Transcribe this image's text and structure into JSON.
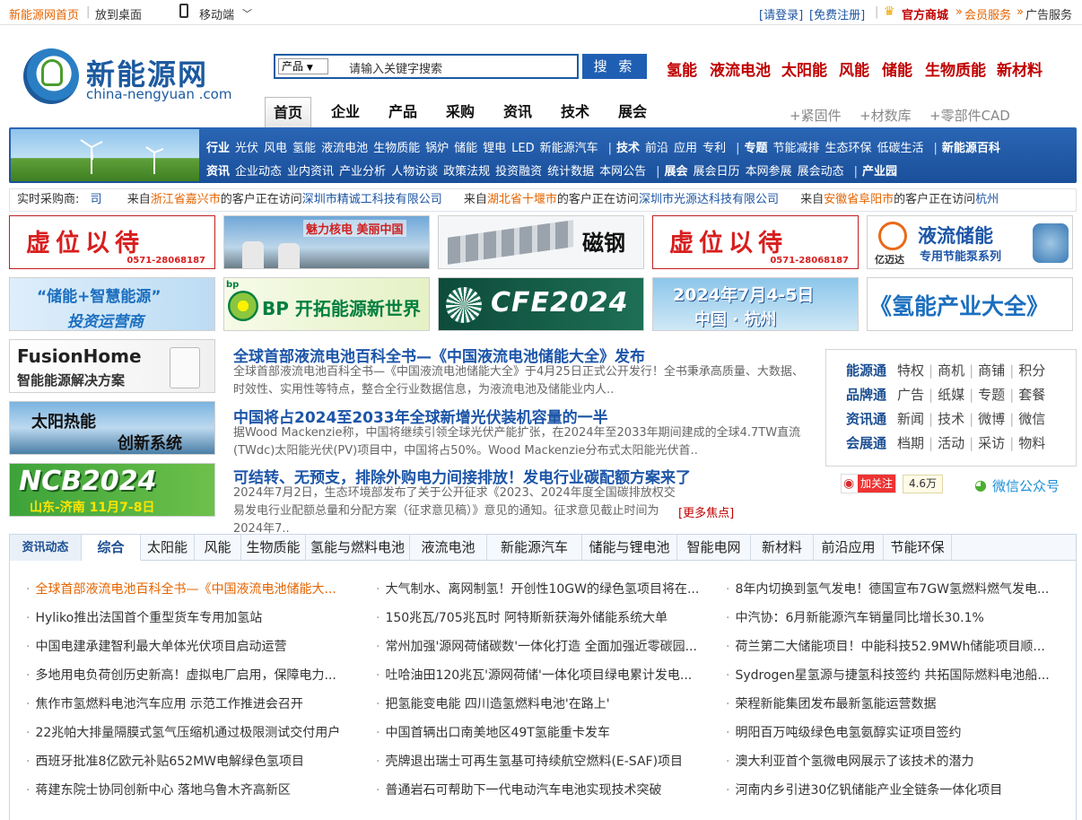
{
  "topbar": {
    "home": "新能源网首页",
    "desktop": "放到桌面",
    "mobile": "移动端",
    "login": "[请登录]",
    "register": "[免费注册]",
    "mall": "官方商城",
    "vip": "会员服务",
    "ads": "广告服务"
  },
  "logo": {
    "cn": "新能源网",
    "en": "china-nengyuan .com"
  },
  "search": {
    "select": "产品",
    "placeholder": "请输入关键字搜索",
    "button": "搜 索"
  },
  "hotcats": [
    "氢能",
    "液流电池",
    "太阳能",
    "风能",
    "储能",
    "生物质能",
    "新材料"
  ],
  "nav": {
    "tabs": [
      "首页",
      "企业",
      "产品",
      "采购",
      "资讯",
      "技术",
      "展会"
    ],
    "extra": [
      "+紧固件",
      "+材数库",
      "+零部件CAD"
    ]
  },
  "band": {
    "row1": [
      {
        "t": "行业",
        "b": true
      },
      {
        "t": "光伏"
      },
      {
        "t": "风电"
      },
      {
        "t": "氢能"
      },
      {
        "t": "液流电池"
      },
      {
        "t": "生物质能"
      },
      {
        "t": "锅炉"
      },
      {
        "t": "储能"
      },
      {
        "t": "锂电"
      },
      {
        "t": "LED"
      },
      {
        "t": "新能源汽车",
        "sep": true
      },
      {
        "t": "技术",
        "b": true
      },
      {
        "t": "前沿"
      },
      {
        "t": "应用"
      },
      {
        "t": "专利",
        "sep": true
      },
      {
        "t": "专题",
        "b": true
      },
      {
        "t": "节能减排"
      },
      {
        "t": "生态环保"
      },
      {
        "t": "低碳生活",
        "sep": true
      },
      {
        "t": "新能源百科",
        "b": true
      }
    ],
    "row2": [
      {
        "t": "资讯",
        "b": true
      },
      {
        "t": "企业动态"
      },
      {
        "t": "业内资讯"
      },
      {
        "t": "产业分析"
      },
      {
        "t": "人物访谈"
      },
      {
        "t": "政策法规"
      },
      {
        "t": "投资融资"
      },
      {
        "t": "统计数据"
      },
      {
        "t": "本网公告",
        "sep": true
      },
      {
        "t": "展会",
        "b": true
      },
      {
        "t": "展会日历"
      },
      {
        "t": "本网参展"
      },
      {
        "t": "展会动态",
        "sep": true
      },
      {
        "t": "产业园",
        "b": true
      }
    ]
  },
  "ticker": {
    "label": "实时采购商:",
    "items": [
      {
        "a": "司",
        "b": "",
        "c": "",
        "d": ""
      },
      {
        "a": "来自",
        "b": "浙江省嘉兴市",
        "c": "的客户正在访问",
        "d": "深圳市精诚工科技有限公司"
      },
      {
        "a": "来自",
        "b": "湖北省十堰市",
        "c": "的客户正在访问",
        "d": "深圳市光源达科技有限公司"
      },
      {
        "a": "来自",
        "b": "安徽省阜阳市",
        "c": "的客户正在访问",
        "d": "杭州"
      }
    ]
  },
  "ads": {
    "vacant": "虚位以待",
    "phone": "0571-28068187",
    "nuclear": "魅力核电 美丽中国",
    "magnet": "磁钢",
    "flow_storage": "液流储能",
    "flow_sub": "专用节能泵系列",
    "flow_brand": "亿迈达",
    "smart_energy": "“储能+智慧能源”",
    "smart_sub": "投资运营商",
    "bp": "BP 开拓能源新世界",
    "bp_logo": "bp",
    "cfe": "CFE2024",
    "expo_date": "2024年7月4-5日",
    "expo_city": "中国 · 杭州",
    "hydrogen_book": "《氢能产业大全》",
    "fusion_title": "FusionHome",
    "fusion_sub": "智能能源解决方案",
    "solar_thermal_1": "太阳热能",
    "solar_thermal_2": "创新系统",
    "ncb": "NCB2024",
    "ncb_sub": "山东-济南 11月7-8日"
  },
  "headlines": [
    {
      "title": "全球首部液流电池百科全书—《中国液流电池储能大全》发布",
      "body": "全球首部液流电池百科全书—《中国液流电池储能大全》于4月25日正式公开发行！全书秉承高质量、大数据、时效性、实用性等特点，整合全行业数据信息，为液流电池及储能业内人.."
    },
    {
      "title": "中国将占2024至2033年全球新增光伏装机容量的一半",
      "body": "据Wood Mackenzie称，中国将继续引领全球光伏产能扩张，在2024年至2033年期间建成的全球4.7TW直流(TWdc)太阳能光伏(PV)项目中，中国将占50%。Wood Mackenzie分布式太阳能光伏首.."
    },
    {
      "title": "可结转、无预支，排除外购电力间接排放！发电行业碳配额方案来了",
      "body": "2024年7月2日，生态环境部发布了关于公开征求《2023、2024年度全国碳排放权交易发电行业配额总量和分配方案（征求意见稿）》意见的通知。征求意见截止时间为2024年7..",
      "more": "[更多焦点]"
    }
  ],
  "rpanel": [
    {
      "h": "能源通",
      "items": [
        "特权",
        "商机",
        "商铺",
        "积分"
      ]
    },
    {
      "h": "品牌通",
      "items": [
        "广告",
        "纸媒",
        "专题",
        "套餐"
      ]
    },
    {
      "h": "资讯通",
      "items": [
        "新闻",
        "技术",
        "微博",
        "微信"
      ]
    },
    {
      "h": "会展通",
      "items": [
        "档期",
        "活动",
        "采访",
        "物料"
      ]
    }
  ],
  "social": {
    "follow": "加关注",
    "count": "4.6万",
    "wechat": "微信公众号"
  },
  "tabs": {
    "label": "资讯动态",
    "items": [
      "综合",
      "太阳能",
      "风能",
      "生物质能",
      "氢能与燃料电池",
      "液流电池",
      "新能源汽车",
      "储能与锂电池",
      "智能电网",
      "新材料",
      "前沿应用",
      "节能环保"
    ]
  },
  "news": [
    [
      "全球首部液流电池百科全书—《中国液流电池储能大...",
      "大气制水、离网制氢！开创性10GW的绿色氢项目将在...",
      "8年内切换到氢气发电！德国宣布7GW氢燃料燃气发电..."
    ],
    [
      "Hyliko推出法国首个重型货车专用加氢站",
      "150兆瓦/705兆瓦时 阿特斯新获海外储能系统大单",
      "中汽协：6月新能源汽车销量同比增长30.1%"
    ],
    [
      "中国电建承建智利最大单体光伏项目启动运营",
      "常州加强'源网荷储碳数'一体化打造 全面加强近零碳园...",
      "荷兰第二大储能项目！中能科技52.9MWh储能项目顺..."
    ],
    [
      "多地用电负荷创历史新高！虚拟电厂启用，保障电力...",
      "吐哈油田120兆瓦'源网荷储'一体化项目绿电累计发电...",
      "Sydrogen星氢源与捷氢科技签约 共拓国际燃料电池船..."
    ],
    [
      "焦作市氢燃料电池汽车应用 示范工作推进会召开",
      "把氢能变电能 四川造氢燃料电池'在路上'",
      "荣程新能集团发布最新氢能运营数据"
    ],
    [
      "22兆帕大排量隔膜式氢气压缩机通过极限测试交付用户",
      "中国首辆出口南美地区49T氢能重卡发车",
      "明阳百万吨级绿色电氢氨醇实证项目签约"
    ],
    [
      "西班牙批准8亿欧元补贴652MW电解绿色氢项目",
      "壳牌退出瑞士可再生氢基可持续航空燃料(E-SAF)项目",
      "澳大利亚首个氢微电网展示了该技术的潜力"
    ],
    [
      "蒋建东院士协同创新中心 落地乌鲁木齐高新区",
      "普通岩石可帮助下一代电动汽车电池实现技术突破",
      "河南内乡引进30亿钒储能产业全链条一体化项目"
    ]
  ]
}
